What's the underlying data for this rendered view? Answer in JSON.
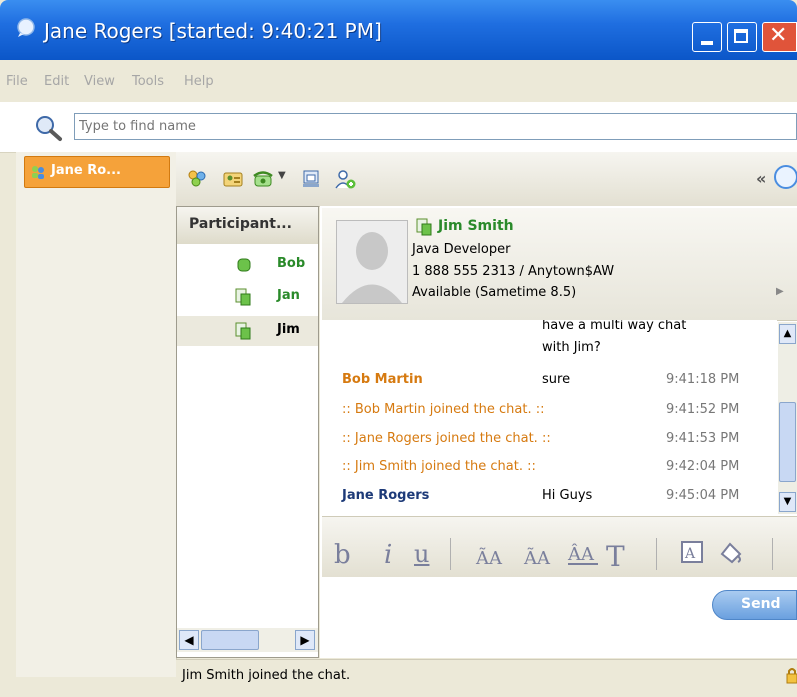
{
  "window": {
    "title": "Jane Rogers [started: 9:40:21 PM]"
  },
  "menu": [
    "File",
    "Edit",
    "View",
    "Tools",
    "Help"
  ],
  "search": {
    "placeholder": "Type to find name",
    "value": ""
  },
  "left_tab": {
    "label": "Jane Ro..."
  },
  "toolbar": {
    "icons": [
      "people-icon",
      "business-card-icon",
      "phone-icon",
      "screen-share-icon",
      "add-person-icon"
    ],
    "collapse": "«"
  },
  "participants": {
    "header": "Participant...",
    "rows": [
      {
        "name": "Bob",
        "icon": "status-dot-icon",
        "color": "#2a8a2a"
      },
      {
        "name": "Jan",
        "icon": "sametime-icon",
        "color": "#2a8a2a"
      },
      {
        "name": "Jim",
        "icon": "sametime-icon",
        "color": "#000000",
        "selected": true
      }
    ]
  },
  "card": {
    "name": "Jim Smith",
    "title": "Java Developer",
    "phone": "1 888 555 2313 / Anytown$AW",
    "status": "Available (Sametime 8.5)"
  },
  "messages": [
    {
      "sender": "",
      "text": "have a multi way chat",
      "time": "",
      "kind": "partial"
    },
    {
      "sender": "",
      "text": "with Jim?",
      "time": "",
      "kind": "partial"
    },
    {
      "sender": "Bob Martin",
      "text": "sure",
      "time": "9:41:18 PM",
      "kind": "msg",
      "color": "#d67a10"
    },
    {
      "sender": "",
      "text": ":: Bob Martin joined the chat. ::",
      "time": "9:41:52 PM",
      "kind": "sys",
      "color": "#d67a10"
    },
    {
      "sender": "",
      "text": ":: Jane Rogers joined the chat. ::",
      "time": "9:41:53 PM",
      "kind": "sys",
      "color": "#d67a10"
    },
    {
      "sender": "",
      "text": ":: Jim Smith joined the chat. ::",
      "time": "9:42:04 PM",
      "kind": "sys",
      "color": "#d67a10"
    },
    {
      "sender": "Jane Rogers",
      "text": "Hi Guys",
      "time": "9:45:04 PM",
      "kind": "msg",
      "color": "#1d3a78"
    }
  ],
  "format": {
    "bold": "b",
    "italic": "i",
    "underline": "u",
    "text": "T"
  },
  "send": {
    "label": "Send"
  },
  "status": {
    "text": "Jim Smith joined the chat."
  }
}
